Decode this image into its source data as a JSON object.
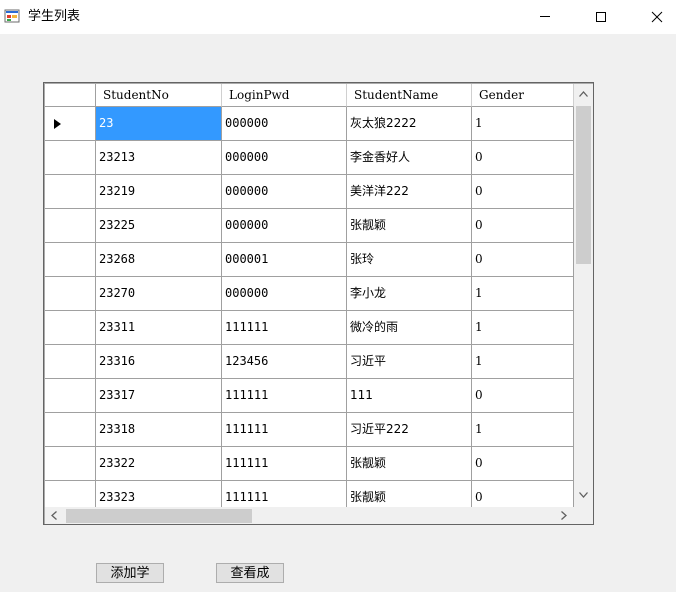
{
  "window": {
    "title": "学生列表",
    "icons": {
      "app": "app-form-icon",
      "minimize": "minimize-icon",
      "maximize": "maximize-icon",
      "close": "close-icon"
    }
  },
  "grid": {
    "columns": [
      "StudentNo",
      "LoginPwd",
      "StudentName",
      "Gender"
    ],
    "rows": [
      [
        "23",
        "000000",
        "灰太狼2222",
        "1"
      ],
      [
        "23213",
        "000000",
        "李金香好人",
        "0"
      ],
      [
        "23219",
        "000000",
        "美洋洋222",
        "0"
      ],
      [
        "23225",
        "000000",
        "张靓颖",
        "0"
      ],
      [
        "23268",
        "000001",
        "张玲",
        "0"
      ],
      [
        "23270",
        "000000",
        "李小龙",
        "1"
      ],
      [
        "23311",
        "111111",
        "微冷的雨",
        "1"
      ],
      [
        "23316",
        "123456",
        "习近平",
        "1"
      ],
      [
        "23317",
        "111111",
        "111",
        "0"
      ],
      [
        "23318",
        "111111",
        "习近平222",
        "1"
      ],
      [
        "23322",
        "111111",
        "张靓颖",
        "0"
      ],
      [
        "23323",
        "111111",
        "张靓颖",
        "0"
      ]
    ],
    "selected_row": 0,
    "current_row_indicator": "row-pointer-icon",
    "selection_color": "#3399ff"
  },
  "buttons": {
    "add": "添加学",
    "view": "查看成"
  }
}
